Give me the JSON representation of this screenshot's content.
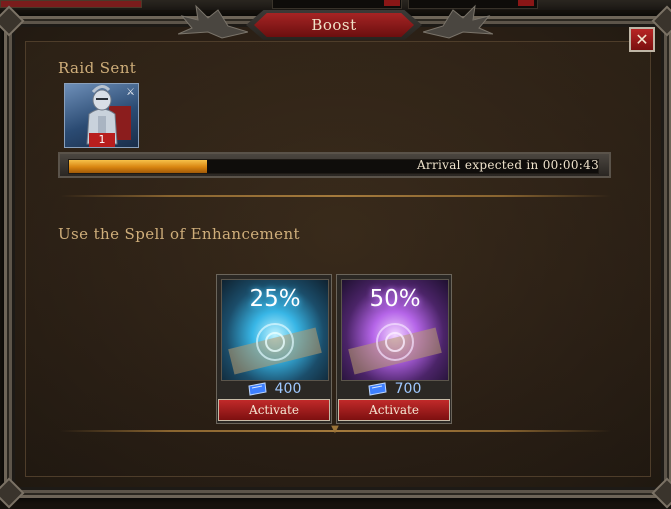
{
  "dialog": {
    "title": "Boost",
    "close_label": "✕"
  },
  "raid": {
    "heading": "Raid Sent",
    "unit_count": "1",
    "progress_fraction": 0.26,
    "arrival_text": "Arrival expected in 00:00:43"
  },
  "enhancement": {
    "heading": "Use the Spell of Enhancement",
    "spells": [
      {
        "percent": "25%",
        "cost": "400",
        "button_label": "Activate"
      },
      {
        "percent": "50%",
        "cost": "700",
        "button_label": "Activate"
      }
    ]
  },
  "colors": {
    "accent_red": "#a52424",
    "heading_gold": "#cfae7a",
    "progress_orange": "#e8920f",
    "gem_blue": "#4a8cff"
  },
  "icons": {
    "close": "close-icon",
    "gem": "gem-icon",
    "unit": "knight-unit-icon",
    "scroll": "scroll-icon"
  }
}
